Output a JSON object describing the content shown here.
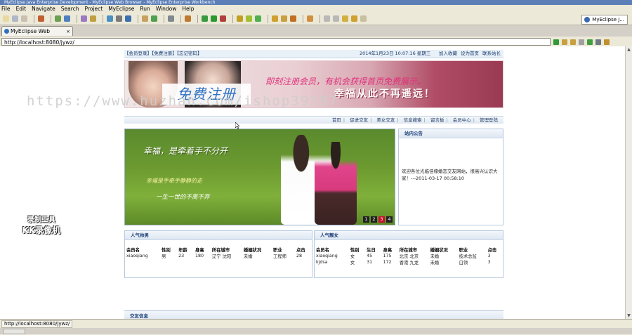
{
  "window": {
    "title": "MyEclipse Java Enterprise Development - MyEclipse Web Browser - MyEclipse Enterprise Workbench"
  },
  "menu": [
    "File",
    "Edit",
    "Navigate",
    "Search",
    "Project",
    "MyEclipse",
    "Run",
    "Window",
    "Help"
  ],
  "perspective": "MyEclipse J...",
  "editor_tab": {
    "label": "MyEclipse Web Browser",
    "close": "×"
  },
  "url": "http://localhost:8080/jywz/",
  "status_url": "http://localhost:8080/jywz/",
  "site": {
    "top_left": "【会员登录】【免费注册】【忘记密码】",
    "date": "2014年1月23日  10:07:16  星期三",
    "favorite": "加入收藏",
    "homepage": "设为首页",
    "contact": "联系站长",
    "banner": {
      "register": "免费注册",
      "slogan1": "即刻注册会员，有机会获得首页免费展示。",
      "slogan2": "幸福从此不再遥远！"
    },
    "nav": [
      "首页",
      "促进交友",
      "美女交友",
      "信息搜索",
      "留言板",
      "会员中心",
      "管理登陆"
    ],
    "slide": {
      "headline": "幸福，是牵着手不分开",
      "line2": "幸福是手牵手静静的走",
      "line3": "一生一世的不离不弃",
      "pages": [
        "1",
        "2",
        "3",
        "4"
      ],
      "active_page": "3"
    },
    "notice": {
      "title": "站内公告",
      "text": "欢迎各位光临佳缘婚恋交友网站，很高兴认识大家！---2011-03-17 00:58:10"
    },
    "male": {
      "title": "人气帅男",
      "headers": [
        "会员名",
        "性别",
        "年龄",
        "身高",
        "所在城市",
        "婚姻状况",
        "职业",
        "点击"
      ],
      "rows": [
        [
          "xiaoqiang",
          "男",
          "23",
          "180",
          "辽宁 沈阳",
          "未婚",
          "工程师",
          "28"
        ]
      ]
    },
    "female": {
      "title": "人气靓女",
      "headers": [
        "会员名",
        "性别",
        "生日",
        "身高",
        "所在城市",
        "婚姻状况",
        "职业",
        "点击"
      ],
      "rows": [
        [
          "xiaoqiang",
          "女",
          "45",
          "175",
          "北京 北京",
          "未婚",
          "技术总监",
          "3"
        ],
        [
          "kjdsa",
          "女",
          "31",
          "172",
          "香港 九龙",
          "未婚",
          "白领",
          "3"
        ]
      ]
    },
    "bottom_title": "交友信息"
  },
  "overlay": {
    "watermark": "https://www.huzhan.com/ishop39397",
    "rec_line1": "录制工具",
    "rec_line2": "KK录像机"
  },
  "colors": {
    "title_bar": "#5c7fb8",
    "panel_header": "#1d3f78",
    "accent_pink": "#e0307a"
  }
}
